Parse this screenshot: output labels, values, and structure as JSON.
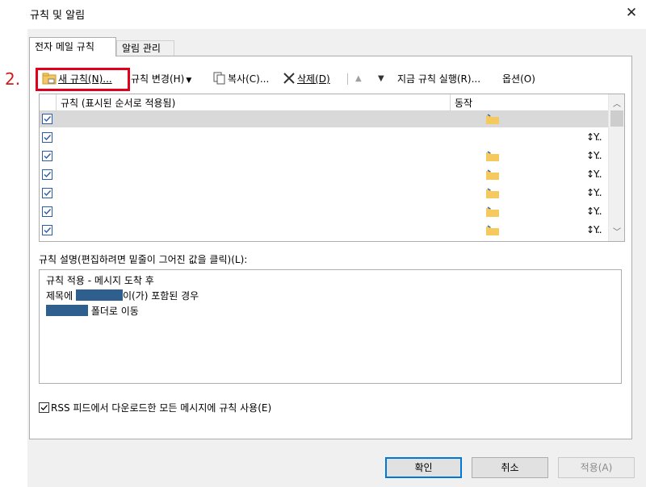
{
  "window": {
    "title": "규칙 및 알림",
    "close_glyph": "✕"
  },
  "tabs": [
    {
      "label": "전자 메일 규칙"
    },
    {
      "label": "알림 관리"
    }
  ],
  "annotation": {
    "step": "2."
  },
  "toolbar": {
    "new_rule": "새 규칙(N)...",
    "change_rule": "규칙 변경(H)",
    "copy": "복사(C)...",
    "delete": "삭제(D)",
    "run_now": "지금 규칙 실행(R)...",
    "options": "옵션(O)"
  },
  "rules_list": {
    "columns": [
      "규칙 (표시된 순서로 적용됨)",
      "동작"
    ],
    "rows": [
      {
        "checked": true,
        "selected": true,
        "move_icon": true,
        "tool_icon": false
      },
      {
        "checked": true,
        "selected": false,
        "move_icon": false,
        "tool_icon": true
      },
      {
        "checked": true,
        "selected": false,
        "move_icon": true,
        "tool_icon": true
      },
      {
        "checked": true,
        "selected": false,
        "move_icon": true,
        "tool_icon": true
      },
      {
        "checked": true,
        "selected": false,
        "move_icon": true,
        "tool_icon": true
      },
      {
        "checked": true,
        "selected": false,
        "move_icon": true,
        "tool_icon": true
      },
      {
        "checked": true,
        "selected": false,
        "move_icon": true,
        "tool_icon": true
      }
    ],
    "tool_text": "↕Y.."
  },
  "description": {
    "label": "규칙 설명(편집하려면 밑줄이 그어진 값을 클릭)(L):",
    "line1": "규칙 적용 - 메시지 도착 후",
    "line2_pre": "제목에",
    "line2_post": "이(가) 포함된 경우",
    "line3_post": "폴더로 이동"
  },
  "rss": {
    "label": "RSS 피드에서 다운로드한 모든 메시지에 규칙 사용(E)",
    "checked": true
  },
  "buttons": {
    "ok": "확인",
    "cancel": "취소",
    "apply": "적용(A)"
  },
  "colors": {
    "accent": "#0078d7",
    "highlight": "#e0001b",
    "redacted": "#2f5f8f"
  }
}
